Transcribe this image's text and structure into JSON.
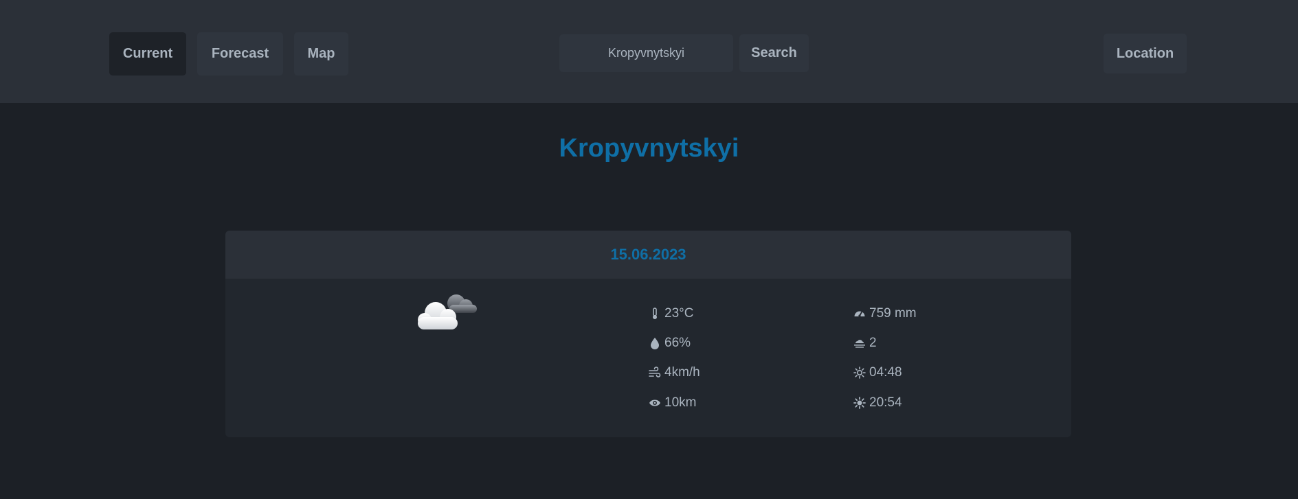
{
  "nav": {
    "current_label": "Current",
    "forecast_label": "Forecast",
    "map_label": "Map"
  },
  "search": {
    "value": "Kropyvnytskyi",
    "button_label": "Search"
  },
  "location_label": "Location",
  "city": "Kropyvnytskyi",
  "card": {
    "date": "15.06.2023",
    "weather_icon": "cloudy-night-icon",
    "stats_left": [
      {
        "icon": "thermometer-icon",
        "value": "23°C"
      },
      {
        "icon": "droplet-icon",
        "value": "66%"
      },
      {
        "icon": "wind-icon",
        "value": "4km/h"
      },
      {
        "icon": "eye-icon",
        "value": "10km"
      }
    ],
    "stats_right": [
      {
        "icon": "gauge-icon",
        "value": "759 mm"
      },
      {
        "icon": "cloud-icon",
        "value": "2"
      },
      {
        "icon": "sunrise-icon",
        "value": "04:48"
      },
      {
        "icon": "sunset-icon",
        "value": "20:54"
      }
    ]
  },
  "colors": {
    "accent": "#0f6fa6",
    "header_bg": "#2b3038",
    "page_bg": "#1c2026",
    "text": "#aab4bf"
  }
}
